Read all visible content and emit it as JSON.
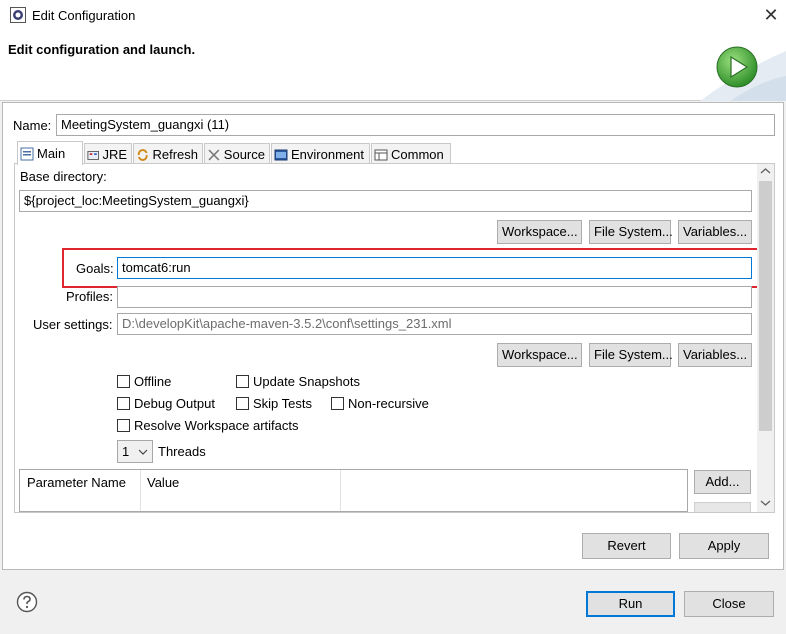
{
  "window": {
    "title": "Edit Configuration",
    "close_label": "✕"
  },
  "header": {
    "title": "Edit configuration and launch."
  },
  "name": {
    "label": "Name:",
    "value": "MeetingSystem_guangxi (11)"
  },
  "tabs": [
    {
      "label": "Main",
      "icon": "main-tab-icon"
    },
    {
      "label": "JRE",
      "icon": "jre-icon"
    },
    {
      "label": "Refresh",
      "icon": "refresh-icon"
    },
    {
      "label": "Source",
      "icon": "source-icon"
    },
    {
      "label": "Environment",
      "icon": "environment-icon"
    },
    {
      "label": "Common",
      "icon": "common-icon"
    }
  ],
  "main": {
    "base_dir_label": "Base directory:",
    "base_dir_value": "${project_loc:MeetingSystem_guangxi}",
    "buttons_row1": [
      "Workspace...",
      "File System...",
      "Variables..."
    ],
    "goals_label": "Goals:",
    "goals_value": "tomcat6:run",
    "profiles_label": "Profiles:",
    "profiles_value": "",
    "user_settings_label": "User settings:",
    "user_settings_value": "D:\\developKit\\apache-maven-3.5.2\\conf\\settings_231.xml",
    "buttons_row2": [
      "Workspace...",
      "File System...",
      "Variables..."
    ],
    "checkboxes": {
      "offline": "Offline",
      "update_snapshots": "Update Snapshots",
      "debug_output": "Debug Output",
      "skip_tests": "Skip Tests",
      "non_recursive": "Non-recursive",
      "resolve_workspace": "Resolve Workspace artifacts"
    },
    "threads_value": "1",
    "threads_label": "Threads",
    "table_headers": [
      "Parameter Name",
      "Value"
    ],
    "add_button": "Add..."
  },
  "footer": {
    "revert": "Revert",
    "apply": "Apply",
    "run": "Run",
    "close": "Close",
    "help_icon": "help-icon"
  },
  "colors": {
    "highlight": "#e0262d",
    "focus": "#0078d7",
    "run_green": "#3fa535"
  }
}
